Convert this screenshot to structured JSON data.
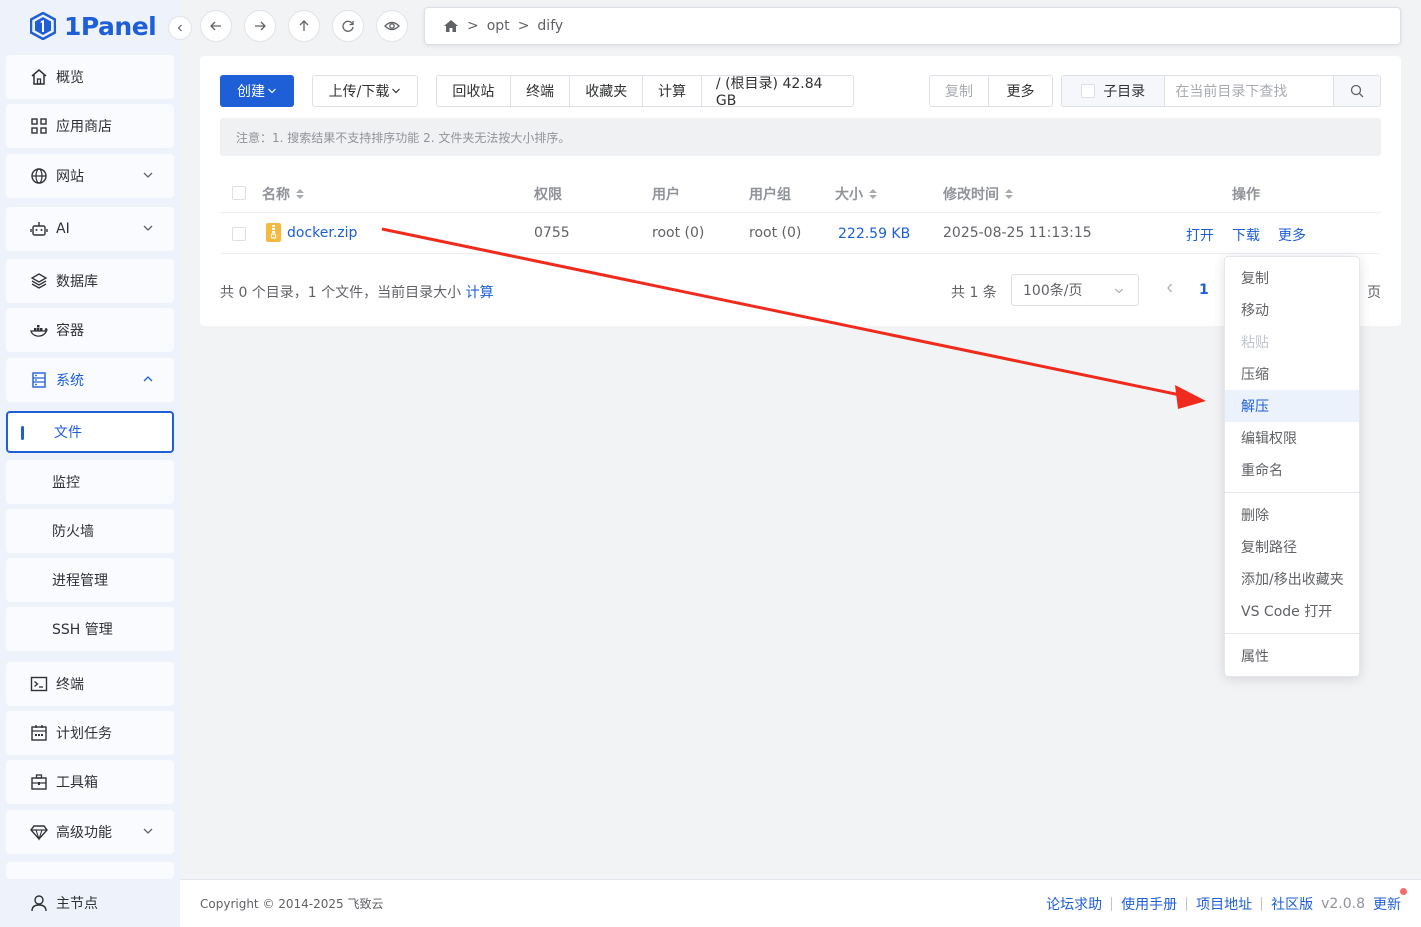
{
  "brand": {
    "name": "1Panel"
  },
  "sidebar": {
    "items": [
      {
        "label": "概览",
        "icon": "home-icon"
      },
      {
        "label": "应用商店",
        "icon": "grid-icon"
      },
      {
        "label": "网站",
        "icon": "globe-icon"
      },
      {
        "label": "AI",
        "icon": "robot-icon"
      },
      {
        "label": "数据库",
        "icon": "layers-icon"
      },
      {
        "label": "容器",
        "icon": "docker-icon"
      },
      {
        "label": "系统",
        "icon": "server-icon"
      },
      {
        "label": "文件"
      },
      {
        "label": "监控"
      },
      {
        "label": "防火墙"
      },
      {
        "label": "进程管理"
      },
      {
        "label": "SSH 管理"
      },
      {
        "label": "终端",
        "icon": "terminal-icon"
      },
      {
        "label": "计划任务",
        "icon": "calendar-icon"
      },
      {
        "label": "工具箱",
        "icon": "toolbox-icon"
      },
      {
        "label": "高级功能",
        "icon": "diamond-icon"
      }
    ],
    "bottom": {
      "label": "主节点",
      "icon": "user-icon"
    }
  },
  "breadcrumb": {
    "items": [
      "opt",
      "dify"
    ],
    "separator": ">"
  },
  "toolbar": {
    "create": "创建",
    "upload": "上传/下载",
    "group1": [
      "回收站",
      "终端",
      "收藏夹",
      "计算",
      "/ (根目录) 42.84 GB"
    ],
    "copy": "复制",
    "more": "更多",
    "subdir": "子目录",
    "search_placeholder": "在当前目录下查找"
  },
  "notice": "注意：1. 搜索结果不支持排序功能 2. 文件夹无法按大小排序。",
  "table": {
    "headers": {
      "name": "名称",
      "perm": "权限",
      "user": "用户",
      "group": "用户组",
      "size": "大小",
      "mtime": "修改时间",
      "ops": "操作"
    },
    "rows": [
      {
        "name": "docker.zip",
        "perm": "0755",
        "user": "root (0)",
        "group": "root (0)",
        "size": "222.59 KB",
        "mtime": "2025-08-25 11:13:15",
        "open": "打开",
        "download": "下载",
        "more": "更多"
      }
    ]
  },
  "summary": {
    "text": "共 0 个目录，1 个文件，当前目录大小",
    "calc": "计算"
  },
  "pagination": {
    "total": "共 1 条",
    "page_size": "100条/页",
    "current": "1",
    "suffix": "页"
  },
  "dropdown": {
    "items": [
      "复制",
      "移动",
      "粘贴",
      "压缩",
      "解压",
      "编辑权限",
      "重命名",
      "删除",
      "复制路径",
      "添加/移出收藏夹",
      "VS Code 打开",
      "属性"
    ]
  },
  "footer": {
    "copyright": "Copyright © 2014-2025 飞致云",
    "links": [
      "论坛求助",
      "使用手册",
      "项目地址",
      "社区版"
    ],
    "version": "v2.0.8",
    "update": "更新"
  },
  "colors": {
    "accent": "#1e5fd8",
    "arrow": "#f02a1c",
    "zip": "#f5b940"
  }
}
